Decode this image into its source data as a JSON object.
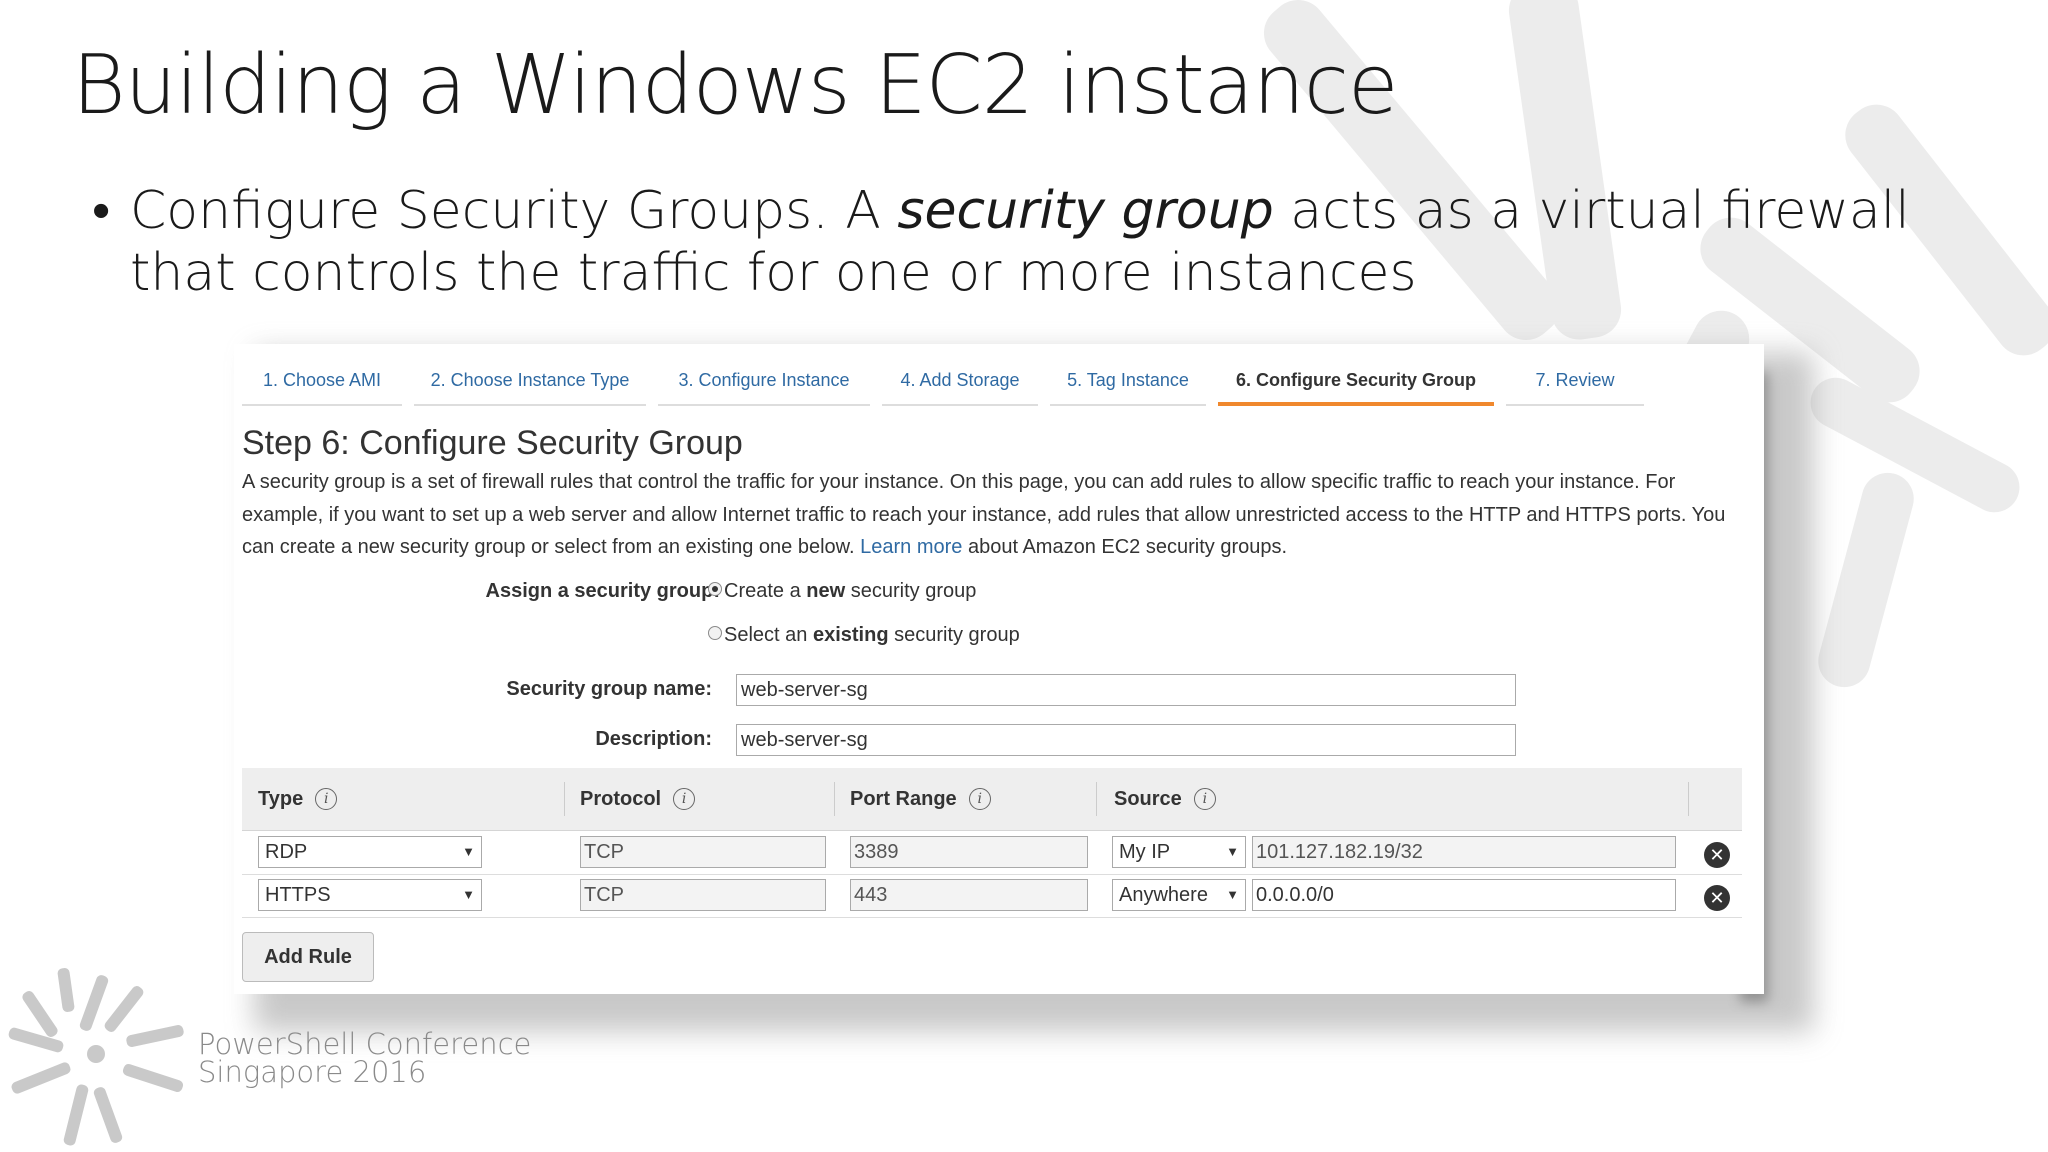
{
  "slide": {
    "title": "Building a Windows EC2 instance",
    "bullet_part1": "Configure Security Groups. A ",
    "bullet_italic": "security group",
    "bullet_part2": " acts as a virtual firewall that controls the traffic for one or more instances"
  },
  "wizard": {
    "tabs": [
      {
        "label": "1. Choose AMI"
      },
      {
        "label": "2. Choose Instance Type"
      },
      {
        "label": "3. Configure Instance"
      },
      {
        "label": "4. Add Storage"
      },
      {
        "label": "5. Tag Instance"
      },
      {
        "label": "6. Configure Security Group"
      },
      {
        "label": "7. Review"
      }
    ],
    "active_tab": "6. Configure Security Group",
    "step_title": "Step 6: Configure Security Group",
    "description": "A security group is a set of firewall rules that control the traffic for your instance. On this page, you can add rules to allow specific traffic to reach your instance. For example, if you want to set up a web server and allow Internet traffic to reach your instance, add rules that allow unrestricted access to the HTTP and HTTPS ports. You can create a new security group or select from an existing one below.",
    "learn_more": "Learn more",
    "description_tail": "about Amazon EC2 security groups.",
    "assign_label": "Assign a security group:",
    "radio_create_pre": "Create a ",
    "radio_create_bold": "new",
    "radio_create_post": " security group",
    "radio_select_pre": "Select an ",
    "radio_select_bold": "existing",
    "radio_select_post": " security group",
    "selected_radio": "create",
    "name_label": "Security group name:",
    "name_value": "web-server-sg",
    "desc_label": "Description:",
    "desc_value": "web-server-sg",
    "columns": {
      "type": "Type",
      "protocol": "Protocol",
      "port_range": "Port Range",
      "source": "Source"
    },
    "rules": [
      {
        "type": "RDP",
        "protocol": "TCP",
        "port": "3389",
        "source_mode": "My IP",
        "source_cidr": "101.127.182.19/32"
      },
      {
        "type": "HTTPS",
        "protocol": "TCP",
        "port": "443",
        "source_mode": "Anywhere",
        "source_cidr": "0.0.0.0/0"
      }
    ],
    "add_rule": "Add Rule"
  },
  "conference": {
    "line1": "PowerShell Conference",
    "line2": "Singapore 2016"
  },
  "colors": {
    "link": "#2f6aa3",
    "active_tab_underline": "#f0882d",
    "table_header_bg": "#eeeeee",
    "logo_gray": "#8a8a8a"
  }
}
